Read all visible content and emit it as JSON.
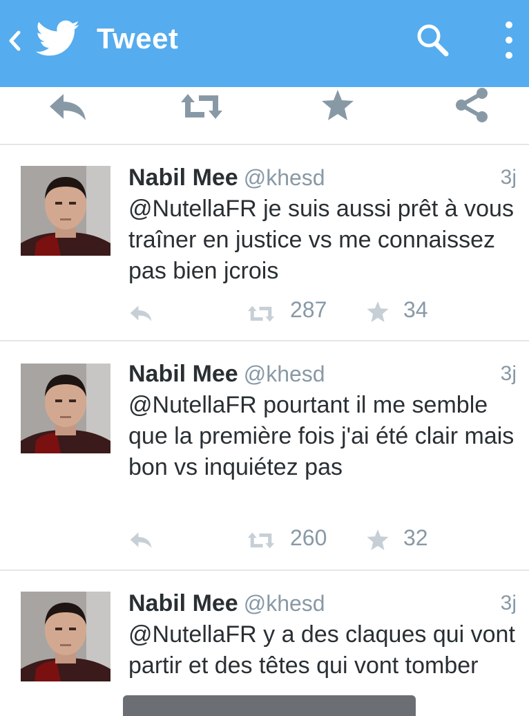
{
  "appbar": {
    "title": "Tweet",
    "icons": [
      "back-chevron-icon",
      "twitter-bird-icon",
      "search-icon",
      "overflow-menu-icon"
    ],
    "background": "#55acee"
  },
  "action_bar": {
    "icons": [
      "reply-icon",
      "retweet-icon",
      "favorite-icon",
      "share-icon"
    ]
  },
  "tweets": [
    {
      "name": "Nabil Mee",
      "handle": "@khesd",
      "time": "3j",
      "text": "@NutellaFR je suis aussi prêt à vous traîner en justice vs me connaissez pas bien jcrois",
      "retweets": "287",
      "favorites": "34"
    },
    {
      "name": "Nabil Mee",
      "handle": "@khesd",
      "time": "3j",
      "text": "@NutellaFR pourtant il me semble que la première fois j'ai été clair mais bon vs inquiétez pas",
      "retweets": "260",
      "favorites": "32"
    },
    {
      "name": "Nabil Mee",
      "handle": "@khesd",
      "time": "3j",
      "text": "@NutellaFR y a des claques qui vont partir et des têtes qui vont tomber"
    }
  ],
  "colors": {
    "accent": "#55acee",
    "text": "#292f33",
    "muted": "#8899a6",
    "divider": "#e3e6e9"
  }
}
